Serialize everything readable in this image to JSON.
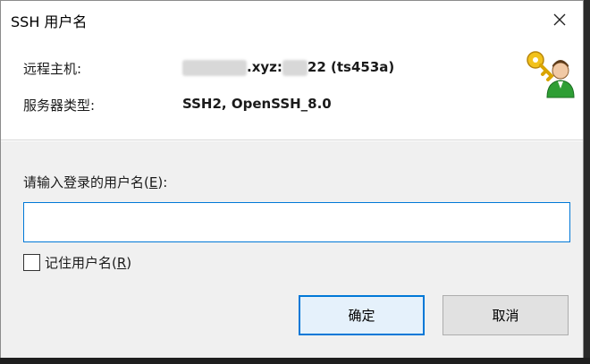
{
  "window": {
    "title": "SSH 用户名"
  },
  "info": {
    "host_label": "远程主机:",
    "host_value_visible": ".xyz:",
    "host_value_tail": "22 (ts453a)",
    "server_type_label": "服务器类型:",
    "server_type_value": "SSH2, OpenSSH_8.0"
  },
  "form": {
    "prompt_pre": "请输入登录的用户名(",
    "prompt_key": "E",
    "prompt_post": "):",
    "username_value": "",
    "remember_pre": "记住用户名(",
    "remember_key": "R",
    "remember_post": ")"
  },
  "buttons": {
    "ok_label": "确定",
    "cancel_label": "取消"
  },
  "icons": {
    "close": "close-icon",
    "logo": "key-user-icon"
  },
  "colors": {
    "focus_border": "#0078d7",
    "panel_bg": "#f0f0f0",
    "button_bg": "#e1e1e1"
  }
}
